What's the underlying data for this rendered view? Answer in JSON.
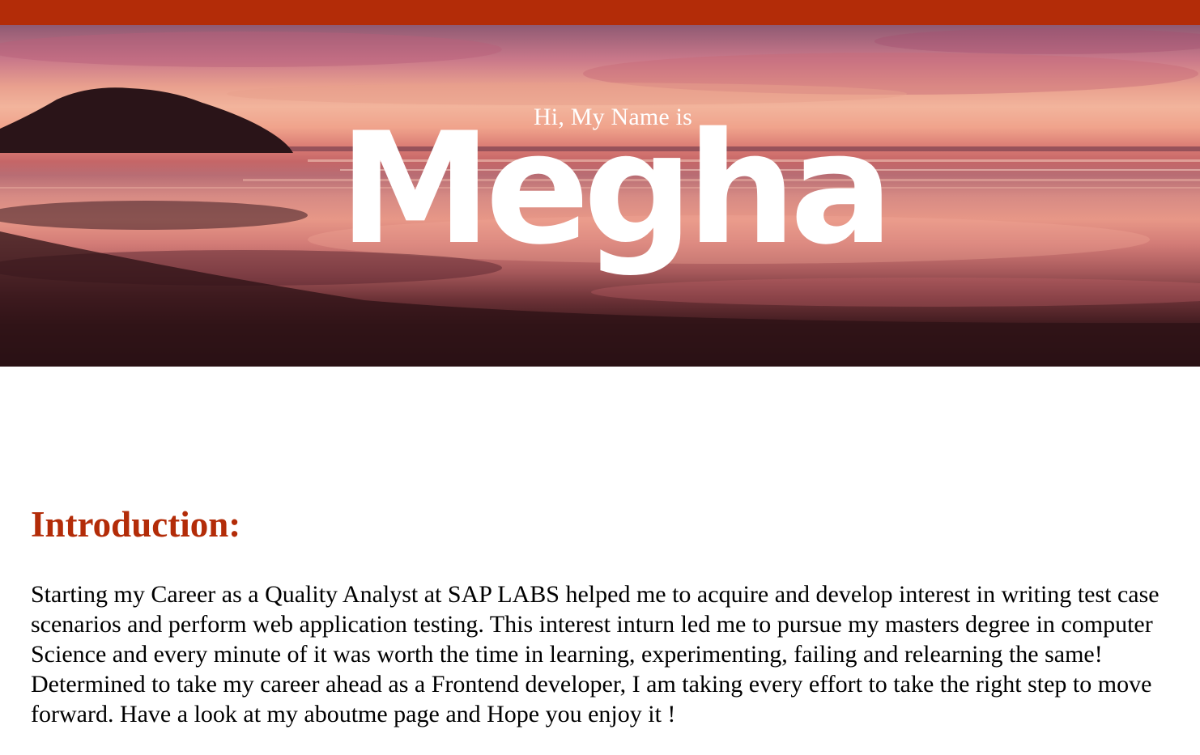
{
  "header": {
    "accent_color": "#b32c08"
  },
  "hero": {
    "greeting": "Hi, My Name is",
    "name": "Megha",
    "background": "sunset-beach-photo"
  },
  "intro": {
    "heading": "Introduction:",
    "heading_color": "#b32c08",
    "body": "Starting my Career as a Quality Analyst at SAP LABS helped me to acquire and develop interest in writing test case scenarios and perform web application testing. This interest inturn led me to pursue my masters degree in computer Science and every minute of it was worth the time in learning, experimenting, failing and relearning the same! Determined to take my career ahead as a Frontend developer, I am taking every effort to take the right step to move forward. Have a look at my aboutme page and Hope you enjoy it !"
  }
}
